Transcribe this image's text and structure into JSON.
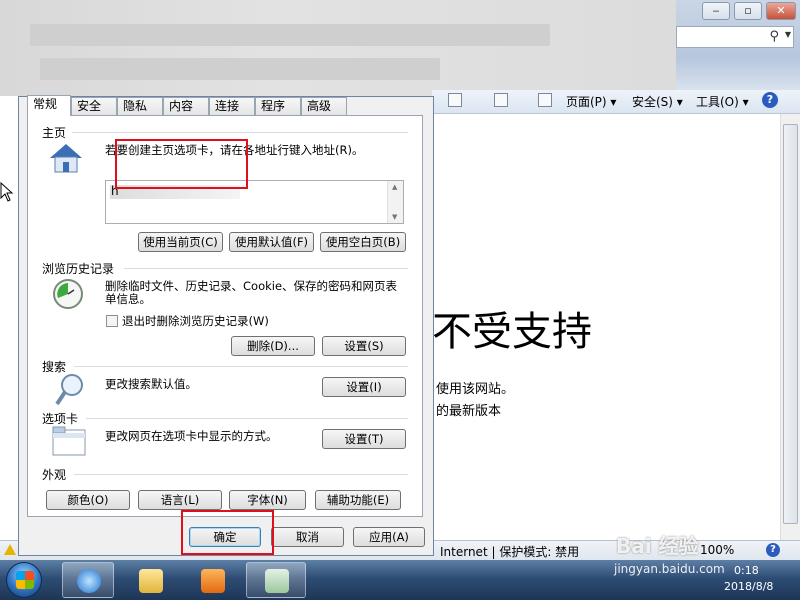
{
  "browser": {
    "caption": {
      "minimize": "‒",
      "maximize": "▫",
      "close": "✕"
    },
    "command_bar": {
      "page": "页面(P) ▾",
      "safety": "安全(S) ▾",
      "tools": "工具(O) ▾",
      "help": "?"
    },
    "content": {
      "title": "不受支持",
      "line1": "使用该网站。",
      "line2": "的最新版本"
    },
    "status": {
      "zone": "Internet | 保护模式: 禁用",
      "zoom": "100%",
      "help": "?"
    }
  },
  "dialog": {
    "tabs": [
      "常规",
      "安全",
      "隐私",
      "内容",
      "连接",
      "程序",
      "高级"
    ],
    "home": {
      "title": "主页",
      "desc": "若要创建主页选项卡，请在各地址行键入地址(R)。",
      "url": "h",
      "btn_current": "使用当前页(C)",
      "btn_default": "使用默认值(F)",
      "btn_blank": "使用空白页(B)"
    },
    "history": {
      "title": "浏览历史记录",
      "desc": "删除临时文件、历史记录、Cookie、保存的密码和网页表单信息。",
      "checkbox": "退出时删除浏览历史记录(W)",
      "btn_delete": "删除(D)...",
      "btn_settings": "设置(S)"
    },
    "search": {
      "title": "搜索",
      "desc": "更改搜索默认值。",
      "btn_settings": "设置(I)"
    },
    "tabs_group": {
      "title": "选项卡",
      "desc": "更改网页在选项卡中显示的方式。",
      "btn_settings": "设置(T)"
    },
    "appearance": {
      "title": "外观",
      "btn_colors": "颜色(O)",
      "btn_languages": "语言(L)",
      "btn_fonts": "字体(N)",
      "btn_accessibility": "辅助功能(E)"
    },
    "footer": {
      "ok": "确定",
      "cancel": "取消",
      "apply": "应用(A)"
    }
  },
  "taskbar": {
    "clock_time": "0:18",
    "clock_date": "2018/8/8"
  },
  "watermark": {
    "brand": "Bai 经验",
    "url": "jingyan.baidu.com"
  },
  "colors": {
    "highlight_box": "#e0101a",
    "taskbar": "#2e4d74"
  }
}
